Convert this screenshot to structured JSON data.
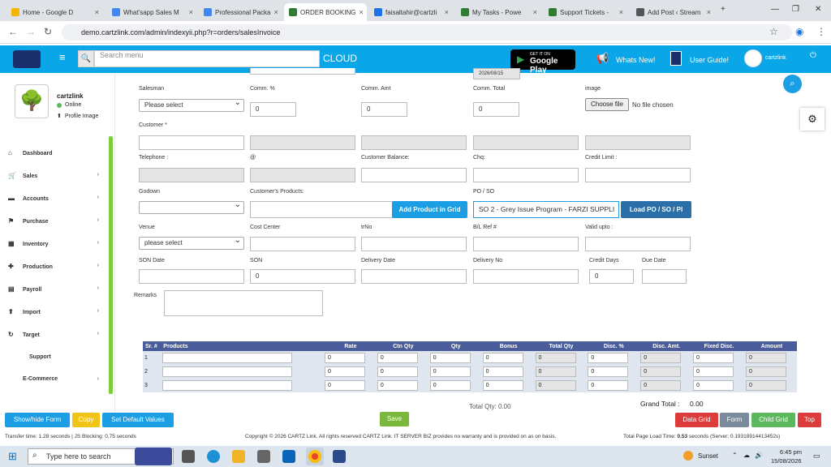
{
  "browser": {
    "tabs": [
      {
        "label": "Home - Google D",
        "color": "#f4b400"
      },
      {
        "label": "What'sapp Sales M",
        "color": "#4285f4"
      },
      {
        "label": "Professional Packa",
        "color": "#4285f4"
      },
      {
        "label": "ORDER BOOKING",
        "color": "#2e7d32"
      },
      {
        "label": "faisaltahir@cartzli",
        "color": "#1a73e8"
      },
      {
        "label": "My Tasks - Powe",
        "color": "#2e7d32"
      },
      {
        "label": "Support Tickets -",
        "color": "#2e7d32"
      },
      {
        "label": "Add Post ‹ Stream",
        "color": "#555555"
      }
    ],
    "new_tab": "+",
    "url": "demo.cartzlink.com/admin/indexyii.php?r=orders/salesInvoice"
  },
  "header": {
    "search_placeholder": "Search menu",
    "cloud": "CLOUD",
    "gplay_small": "GET IT ON",
    "gplay_big": "Google Play",
    "whats_new": "Whats New!",
    "user_guide": "User Guide!",
    "username": "cartzlink"
  },
  "sidebar": {
    "user": "cartzlink",
    "status": "Online",
    "profile": "Profile Image",
    "items": [
      {
        "label": "Dashboard",
        "chevron": ""
      },
      {
        "label": "Sales",
        "chevron": "›"
      },
      {
        "label": "Accounts",
        "chevron": "›"
      },
      {
        "label": "Purchase",
        "chevron": "›"
      },
      {
        "label": "Inventory",
        "chevron": "›"
      },
      {
        "label": "Production",
        "chevron": "›"
      },
      {
        "label": "Payroll",
        "chevron": "›"
      },
      {
        "label": "Import",
        "chevron": "›"
      },
      {
        "label": "Target",
        "chevron": "›"
      },
      {
        "label": "Support",
        "chevron": ""
      },
      {
        "label": "E-Commerce",
        "chevron": "›"
      }
    ]
  },
  "form": {
    "date_value": "2026/08/15",
    "salesman_label": "Salesman",
    "salesman_value": "Please select",
    "comm_pct_label": "Comm. %",
    "comm_pct_value": "0",
    "comm_amt_label": "Comm. Amt",
    "comm_amt_value": "0",
    "comm_total_label": "Comm. Total",
    "comm_total_value": "0",
    "image_label": "image",
    "choose_file": "Choose file",
    "no_file": "No file chosen",
    "customer_label": "Customer *",
    "telephone_label": "Telephone :",
    "at_label": "@",
    "customer_balance_label": "Customer Balance:",
    "chq_label": "Chq:",
    "credit_limit_label": "Credit Limit :",
    "godown_label": "Godown",
    "customer_products_label": "Customer's Products:",
    "add_product_btn": "Add Product in Grid",
    "po_so_label": "PO / SO",
    "po_so_value": "SO 2 - Grey Issue Program - FARZI SUPPLI",
    "load_po_btn": "Load PO / SO / PI",
    "venue_label": "Venue",
    "venue_value": "please select",
    "cost_center_label": "Cost Center",
    "trno_label": "trNo",
    "bl_ref_label": "B/L Ref #",
    "valid_upto_label": "Valid upto :",
    "son_date_label": "SON Date",
    "son_label": "SON",
    "son_value": "0",
    "delivery_date_label": "Delivery Date",
    "delivery_no_label": "Delivery No",
    "credit_days_label": "Credit Days",
    "credit_days_value": "0",
    "due_date_label": "Due Date",
    "remarks_label": "Remarks"
  },
  "grid": {
    "headers": [
      "Sr. #",
      "Products",
      "Rate",
      "Ctn Qty",
      "Qty",
      "Bonus",
      "Total Qty",
      "Disc. %",
      "Disc. Amt.",
      "Fixed Disc.",
      "Amount"
    ],
    "rows": [
      {
        "sr": "1",
        "vals": [
          "0",
          "0",
          "0",
          "0",
          "0",
          "0",
          "0",
          "0",
          "0"
        ]
      },
      {
        "sr": "2",
        "vals": [
          "0",
          "0",
          "0",
          "0",
          "0",
          "0",
          "0",
          "0",
          "0"
        ]
      },
      {
        "sr": "3",
        "vals": [
          "0",
          "0",
          "0",
          "0",
          "0",
          "0",
          "0",
          "0",
          "0"
        ]
      }
    ],
    "total_qty": "Total Qty: 0.00",
    "grand_total_label": "Grand Total :",
    "grand_total_value": "0.00"
  },
  "buttons": {
    "show_hide": "Show/hide Form",
    "copy": "Copy",
    "set_default": "Set Default Values",
    "save": "Save",
    "data_grid": "Data Grid",
    "form": "Form",
    "child_grid": "Child Grid",
    "top": "Top"
  },
  "status": {
    "transfer": "Transfer time: 1.28 seconds | JS Blocking: 0.75 seconds",
    "copyright": "Copyright © 2026 CARTZ Link. All rights reserved CARTZ Link. IT SERVER BIZ provides no warranty and is provided on as on basis.",
    "load_prefix": "Total Page Load Time: ",
    "load_value": "0.53",
    "load_suffix": " seconds (Server: 0.19318914413452s)"
  },
  "taskbar": {
    "search": "Type here to search",
    "weather": "Sunset",
    "time": "6:45 pm",
    "date": "15/08/2026"
  }
}
